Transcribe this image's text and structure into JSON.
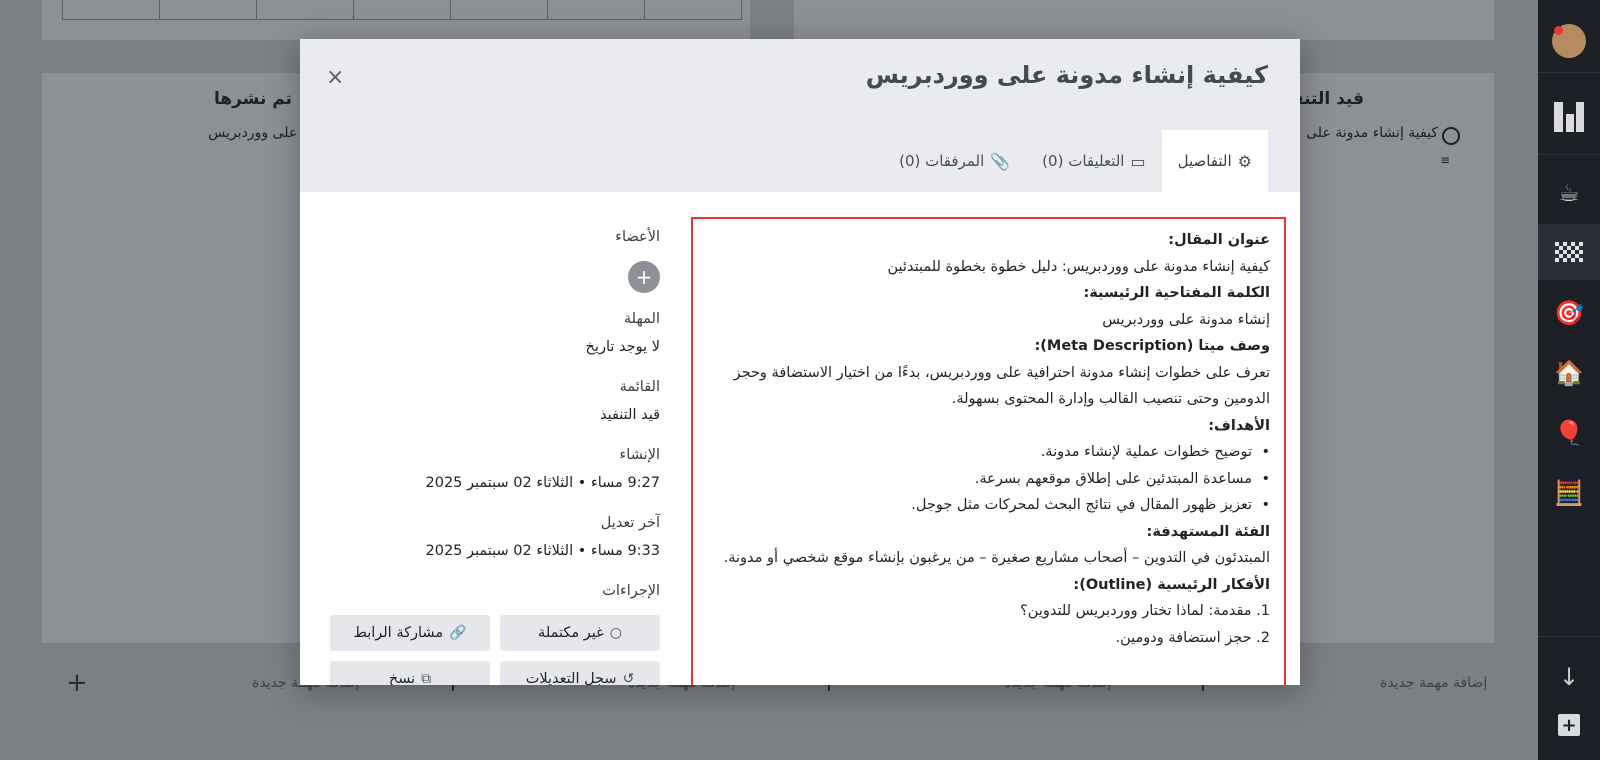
{
  "modal": {
    "title": "كيفية إنشاء مدونة على ووردبريس",
    "close_icon": "×",
    "tabs": [
      {
        "label": "التفاصيل",
        "icon": "⚙"
      },
      {
        "label": "التعليقات (0)",
        "icon": "▭"
      },
      {
        "label": "المرفقات (0)",
        "icon": "📎"
      }
    ]
  },
  "content": {
    "article_title_label": "عنوان المقال:",
    "article_title": "كيفية إنشاء مدونة على ووردبريس: دليل خطوة بخطوة للمبتدئين",
    "keyword_label": "الكلمة المفتاحية الرئيسية:",
    "keyword": "إنشاء مدونة على ووردبريس",
    "meta_label": "وصف ميتا (Meta Description):",
    "meta_text": "تعرف على خطوات إنشاء مدونة احترافية على ووردبريس، بدءًا من اختيار الاستضافة وحجز الدومين وحتى تنصيب القالب وإدارة المحتوى بسهولة.",
    "goals_label": "الأهداف:",
    "goals": [
      "توضيح خطوات عملية لإنشاء مدونة.",
      "مساعدة المبتدئين على إطلاق موقعهم بسرعة.",
      "تعزيز ظهور المقال في نتائج البحث لمحركات مثل جوجل."
    ],
    "audience_label": "الفئة المستهدفة:",
    "audience": "المبتدئون في التدوين – أصحاب مشاريع صغيرة – من يرغبون بإنشاء موقع شخصي أو مدونة.",
    "outline_label": "الأفكار الرئيسية (Outline):",
    "outline": [
      "1. مقدمة: لماذا تختار ووردبريس للتدوين؟",
      "2. حجز استضافة ودومين."
    ]
  },
  "meta": {
    "members_label": "الأعضاء",
    "add_member": "+",
    "deadline_label": "المهلة",
    "deadline_value": "لا يوجد تاريخ",
    "list_label": "القائمة",
    "list_value": "قيد التنفيذ",
    "created_label": "الإنشاء",
    "created_value": "9:27 مساء • الثلاثاء 02 سبتمبر 2025",
    "modified_label": "آخر تعديل",
    "modified_value": "9:33 مساء • الثلاثاء 02 سبتمبر 2025",
    "actions_label": "الإجراءات",
    "actions": [
      {
        "label": "غير مكتملة",
        "icon": "○"
      },
      {
        "label": "مشاركة الرابط",
        "icon": "🔗"
      },
      {
        "label": "سجل التعديلات",
        "icon": "↺"
      },
      {
        "label": "نسخ",
        "icon": "⧉"
      }
    ]
  },
  "board": {
    "in_progress_title": "قيد التنفيذ",
    "in_progress_card": "كيفية إنشاء مدونة على",
    "published_title": "تم نشرها",
    "published_card": "ة حماية المحتوى على ووردبريس",
    "add_task": "إضافة مهمة جديدة",
    "add_plus": "+"
  }
}
